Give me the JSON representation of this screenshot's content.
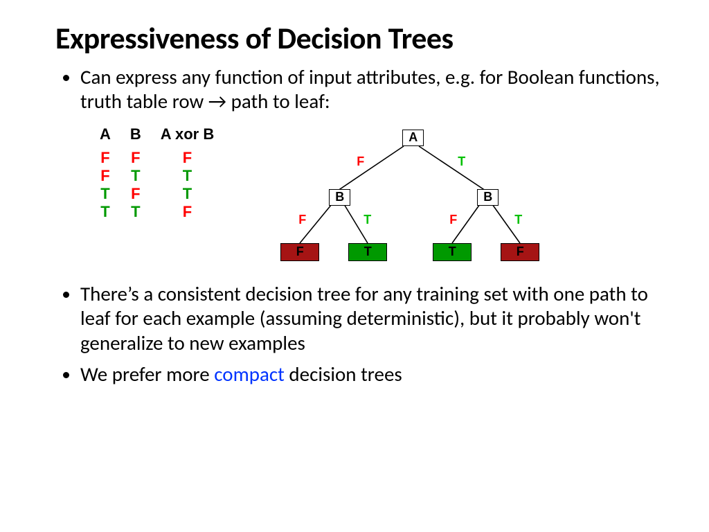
{
  "title": "Expressiveness of Decision Trees",
  "bullet1": "Can express any function of input attributes, e.g. for Boolean functions, truth table row → path to leaf:",
  "truth_table": {
    "headers": {
      "a": "A",
      "b": "B",
      "xor": "A xor B"
    },
    "rows": [
      {
        "a": "F",
        "b": "F",
        "xor": "F"
      },
      {
        "a": "F",
        "b": "T",
        "xor": "T"
      },
      {
        "a": "T",
        "b": "F",
        "xor": "T"
      },
      {
        "a": "T",
        "b": "T",
        "xor": "F"
      }
    ]
  },
  "tree": {
    "root": "A",
    "left": "B",
    "right": "B",
    "edges": {
      "f": "F",
      "t": "T"
    },
    "leaves": [
      "F",
      "T",
      "T",
      "F"
    ]
  },
  "bullet2": "There’s a consistent decision tree for any training set with one path to leaf for each example (assuming deterministic), but it probably won't generalize to new examples",
  "bullet3a": "We prefer more ",
  "bullet3_compact": "compact",
  "bullet3b": " decision trees"
}
